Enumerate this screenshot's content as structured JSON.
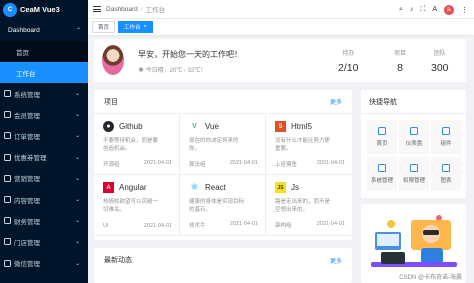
{
  "app": {
    "logo_initials": "C",
    "title": "CeaM Vue3"
  },
  "sidebar": {
    "dashboard": {
      "label": "Dashboard",
      "items": [
        "首页",
        "工作台"
      ]
    },
    "items": [
      "系统管理",
      "会员管理",
      "订单管理",
      "优惠券管理",
      "营销管理",
      "内容管理",
      "财务管理",
      "门店管理",
      "微信管理"
    ]
  },
  "header": {
    "breadcrumb": [
      "Dashboard",
      "工作台"
    ],
    "avatar_text": "头"
  },
  "tags": [
    {
      "label": "首页",
      "active": false
    },
    {
      "label": "工作台",
      "active": true,
      "close": "×"
    }
  ],
  "welcome": {
    "greeting": "早安，开始您一天的工作吧！",
    "weather": "今日晴，20℃ - 32℃！",
    "stats": [
      {
        "label": "待办",
        "value": "2/10"
      },
      {
        "label": "项目",
        "value": "8"
      },
      {
        "label": "团队",
        "value": "300"
      }
    ]
  },
  "projects": {
    "title": "项目",
    "more": "更多",
    "items": [
      {
        "name": "Github",
        "desc": "不要等待机会，而是要创造机会。",
        "tag": "开源组",
        "date": "2021-04-01",
        "icon_color": "#24292e",
        "icon": "github-icon"
      },
      {
        "name": "Vue",
        "desc": "现在的你决定将来的你。",
        "tag": "算法组",
        "date": "2021-04-01",
        "icon_color": "#42b883",
        "icon": "vue-icon"
      },
      {
        "name": "Html5",
        "desc": "没有什么才能比努力更重要。",
        "tag": "上班摸鱼",
        "date": "2021-04-01",
        "icon_color": "#e34f26",
        "icon": "html5-icon"
      },
      {
        "name": "Angular",
        "desc": "热情和欲望可以突破一切难关。",
        "tag": "UI",
        "date": "2021-04-01",
        "icon_color": "#dd0031",
        "icon": "angular-icon"
      },
      {
        "name": "React",
        "desc": "健康的身体是实现目标的基石。",
        "tag": "技术牛",
        "date": "2021-04-01",
        "icon_color": "#61dafb",
        "icon": "react-icon"
      },
      {
        "name": "Js",
        "desc": "路是走出来的，而不是空想出来的。",
        "tag": "架构组",
        "date": "2021-04-01",
        "icon_color": "#f7df1e",
        "icon": "js-icon"
      }
    ]
  },
  "dynamics": {
    "title": "最新动态",
    "more": "更多"
  },
  "quicknav": {
    "title": "快捷导航",
    "items": [
      "首页",
      "仪表盘",
      "组件",
      "系统管理",
      "权限管理",
      "图表"
    ]
  },
  "watermark": "CSDN @卡布奇诺-海晨",
  "colors": {
    "primary": "#1890ff",
    "sidebar": "#001529"
  }
}
